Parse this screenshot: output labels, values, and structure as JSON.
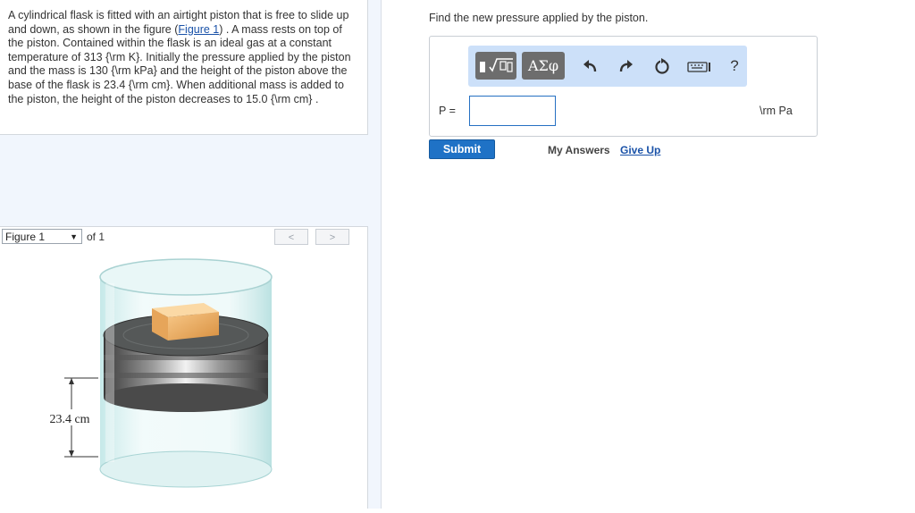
{
  "problem": {
    "text_before_link": "A cylindrical flask is fitted with an airtight piston that is free to slide up and down, as shown in the figure (",
    "link_text": "Figure 1",
    "text_after_link": ") . A mass rests on top of the piston. Contained within the flask is an ideal gas at a constant temperature of 313 {\\rm K}. Initially the pressure applied by the piston and the mass is 130 {\\rm kPa} and the height of the piston above the base of the flask is 23.4 {\\rm cm}. When additional mass is added to the piston, the height of the piston decreases to 15.0 {\\rm cm} ."
  },
  "figure_nav": {
    "selected": "Figure 1",
    "of_text": "of 1",
    "prev": "<",
    "next": ">"
  },
  "figure": {
    "height_label": "23.4 cm"
  },
  "question": {
    "prompt": "Find the new pressure applied by the piston.",
    "variable_label": "P =",
    "input_value": "",
    "unit": "\\rm Pa"
  },
  "toolbar": {
    "templates_icon": "sqrt-template-icon",
    "symbols_label": "ΑΣφ",
    "undo_icon": "undo-icon",
    "redo_icon": "redo-icon",
    "reset_icon": "reset-icon",
    "keyboard_icon": "keyboard-icon",
    "help_label": "?"
  },
  "actions": {
    "submit": "Submit",
    "my_answers": "My Answers",
    "give_up": "Give Up"
  },
  "colors": {
    "submit_bg": "#1f72c6",
    "toolbar_bg": "#cce0f9",
    "link": "#1a52a8"
  }
}
